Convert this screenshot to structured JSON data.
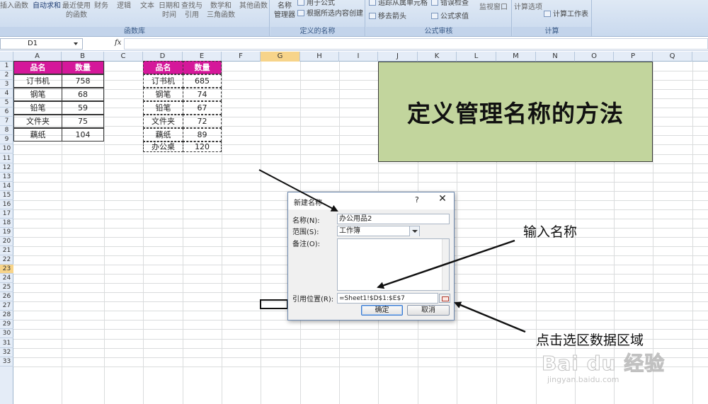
{
  "ribbon": {
    "groups": {
      "function_library": "函数库",
      "defined_names": "定义的名称",
      "formula_auditing": "公式审核",
      "calculation": "计算"
    },
    "buttons": {
      "insert_function": "插入函数",
      "autosum": "自动求和",
      "recent_1": "最近使用",
      "recent_2": "的函数",
      "financial": "财务",
      "logical": "逻辑",
      "text": "文本",
      "datetime_1": "日期和",
      "datetime_2": "时间",
      "lookup_1": "查找与",
      "lookup_2": "引用",
      "math_1": "数学和",
      "math_2": "三角函数",
      "more_functions": "其他函数",
      "name_manager_1": "名称",
      "name_manager_2": "管理器",
      "use_in_formula": "用于公式",
      "create_from_selection": "根据所选内容创建",
      "remove_dependents": "追踪从属单元格",
      "remove_arrows": "移去箭头",
      "error_checking": "错误检查",
      "evaluate_formula": "公式求值",
      "watch_window": "监视窗口",
      "calc_options": "计算选项",
      "calc_sheet": "计算工作表"
    }
  },
  "formula_bar": {
    "name_box": "D1",
    "fx": "fx",
    "formula": ""
  },
  "columns": [
    "A",
    "B",
    "C",
    "D",
    "E",
    "F",
    "G",
    "H",
    "I",
    "J",
    "K",
    "L",
    "M",
    "N",
    "O",
    "P",
    "Q"
  ],
  "selected_column": "G",
  "rows": [
    "1",
    "2",
    "3",
    "4",
    "5",
    "6",
    "7",
    "8",
    "9",
    "10",
    "11",
    "12",
    "13",
    "14",
    "15",
    "16",
    "17",
    "18",
    "19",
    "20",
    "21",
    "22",
    "23",
    "24",
    "25",
    "26",
    "27",
    "28",
    "29",
    "30",
    "31",
    "32",
    "33"
  ],
  "selected_row": "23",
  "table1": {
    "header": [
      "品名",
      "数量"
    ],
    "rows": [
      [
        "订书机",
        "758"
      ],
      [
        "钢笔",
        "68"
      ],
      [
        "铅笔",
        "59"
      ],
      [
        "文件夹",
        "75"
      ],
      [
        "藕纸",
        "104"
      ]
    ]
  },
  "table2": {
    "header": [
      "品名",
      "数量"
    ],
    "rows": [
      [
        "订书机",
        "685"
      ],
      [
        "钢笔",
        "74"
      ],
      [
        "铅笔",
        "67"
      ],
      [
        "文件夹",
        "72"
      ],
      [
        "藕纸",
        "89"
      ],
      [
        "办公桌",
        "120"
      ]
    ]
  },
  "title_box": {
    "text": "定义管理名称的方法",
    "bg_color": "#c2d59d"
  },
  "header_fill_color": "#d5189a",
  "dialog": {
    "title": "新建名称",
    "help": "?",
    "close": "✕",
    "name_label": "名称(N):",
    "name_value": "办公用品2",
    "scope_label": "范围(S):",
    "scope_value": "工作簿",
    "comment_label": "备注(O):",
    "comment_value": "",
    "ref_label": "引用位置(R):",
    "ref_value": "=Sheet1!$D$1:$E$7",
    "ok_label": "确定",
    "cancel_label": "取消"
  },
  "annotations": {
    "enter_name": "输入名称",
    "select_range": "点击选区数据区域"
  },
  "watermark": {
    "logo": "Bai du 经验",
    "url": "jingyan.baidu.com"
  }
}
